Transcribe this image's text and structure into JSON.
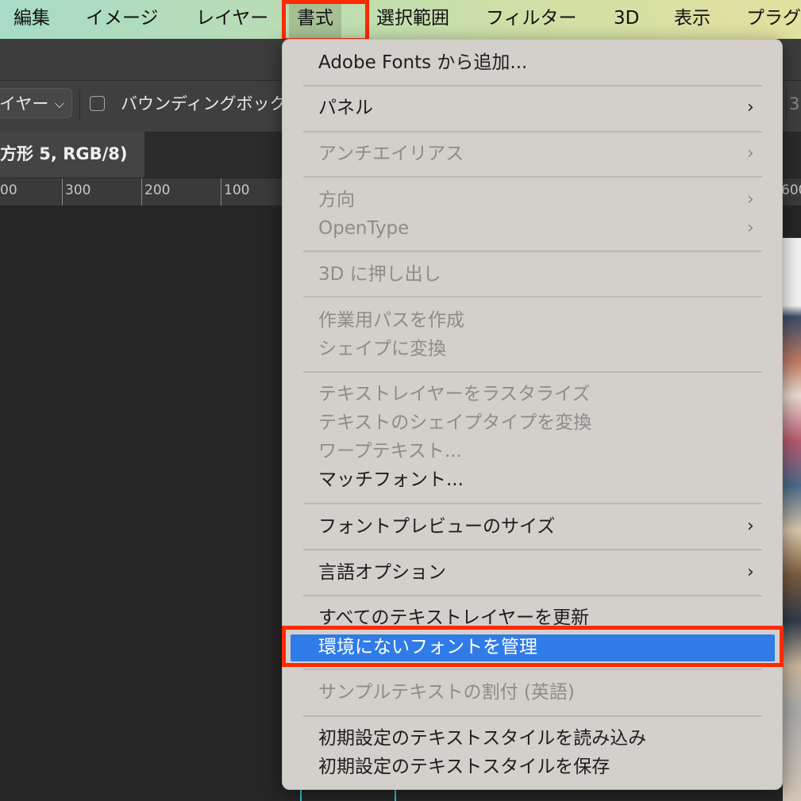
{
  "menubar": {
    "items": [
      "編集",
      "イメージ",
      "レイヤー",
      "書式",
      "選択範囲",
      "フィルター",
      "3D",
      "表示",
      "プラグ"
    ]
  },
  "options_bar": {
    "layer_select": "イヤー",
    "bbox_label": "バウンディングボック",
    "right_value": "3"
  },
  "document": {
    "tab_title": "方形 5, RGB/8)"
  },
  "ruler": {
    "labels": [
      "00",
      "300",
      "200",
      "100",
      "600"
    ]
  },
  "dropdown": {
    "items": {
      "adobe_fonts": "Adobe Fonts から追加...",
      "panel": "パネル",
      "antialias": "アンチエイリアス",
      "direction": "方向",
      "opentype": "OpenType",
      "extrude3d": "3D に押し出し",
      "workpath": "作業用パスを作成",
      "to_shape": "シェイプに変換",
      "rasterize": "テキストレイヤーをラスタライズ",
      "convert_shape_type": "テキストのシェイプタイプを変換",
      "warp": "ワープテキスト...",
      "match_font": "マッチフォント...",
      "font_preview": "フォントプレビューのサイズ",
      "language": "言語オプション",
      "update_all": "すべてのテキストレイヤーを更新",
      "manage_missing": "環境にないフォントを管理",
      "sample_text": "サンプルテキストの割付 (英語)",
      "load_defaults": "初期設定のテキストスタイルを読み込み",
      "save_defaults": "初期設定のテキストスタイルを保存"
    },
    "arrow_glyph": "›"
  },
  "colors": {
    "highlight": "#2f7be8",
    "annotation_red": "#ff2a00"
  }
}
